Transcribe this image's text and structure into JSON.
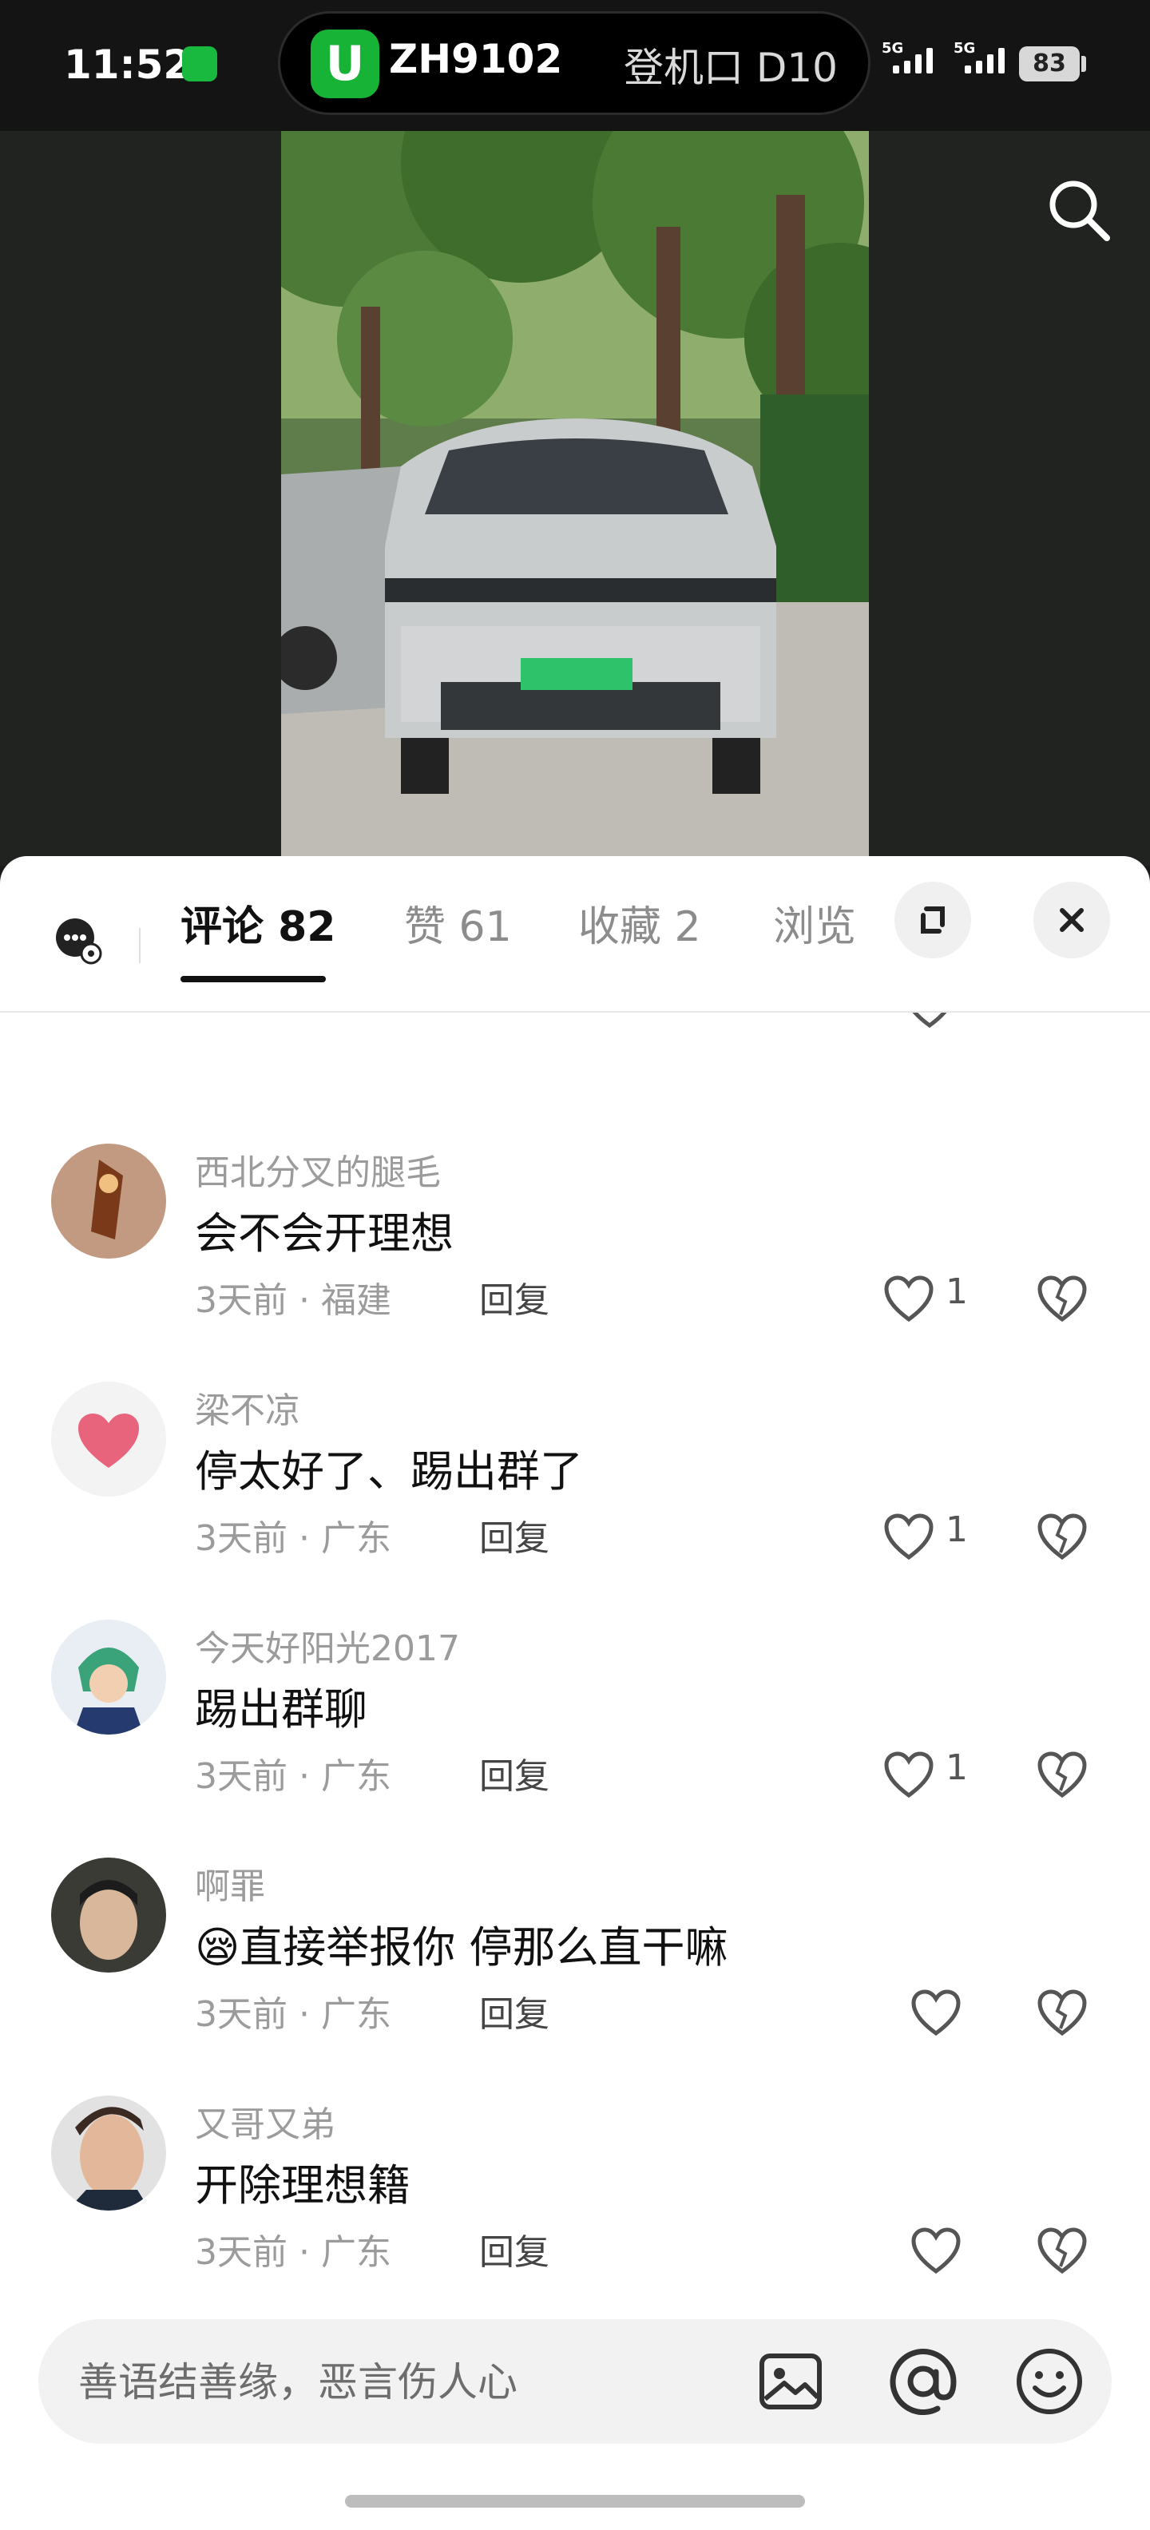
{
  "status_bar": {
    "time": "11:52",
    "island_logo": "U",
    "flight": "ZH9102",
    "gate": "登机口 D10",
    "network_1": "5G",
    "network_2": "5G",
    "battery": "83"
  },
  "colors": {
    "accent_green": "#16b336",
    "text_primary": "#111111",
    "text_secondary": "#9b9b9b"
  },
  "tabs": {
    "comments": "评论 82",
    "likes": "赞 61",
    "favorites": "收藏 2",
    "views": "浏览"
  },
  "comments": [
    {
      "user": "西北分叉的腿毛",
      "text": "会不会开理想",
      "meta": "3天前 · 福建",
      "reply": "回复",
      "likes": "1"
    },
    {
      "user": "梁不凉",
      "text": "停太好了、踢出群了",
      "meta": "3天前 · 广东",
      "reply": "回复",
      "likes": "1"
    },
    {
      "user": "今天好阳光2017",
      "text": "踢出群聊",
      "meta": "3天前 · 广东",
      "reply": "回复",
      "likes": "1"
    },
    {
      "user": "啊罪",
      "emoji": "😪",
      "text": "直接举报你 停那么直干嘛",
      "meta": "3天前 · 广东",
      "reply": "回复",
      "likes": ""
    },
    {
      "user": "又哥又弟",
      "text": "开除理想籍",
      "meta": "3天前 · 广东",
      "reply": "回复",
      "likes": ""
    }
  ],
  "input": {
    "placeholder": "善语结善缘，恶言伤人心"
  }
}
